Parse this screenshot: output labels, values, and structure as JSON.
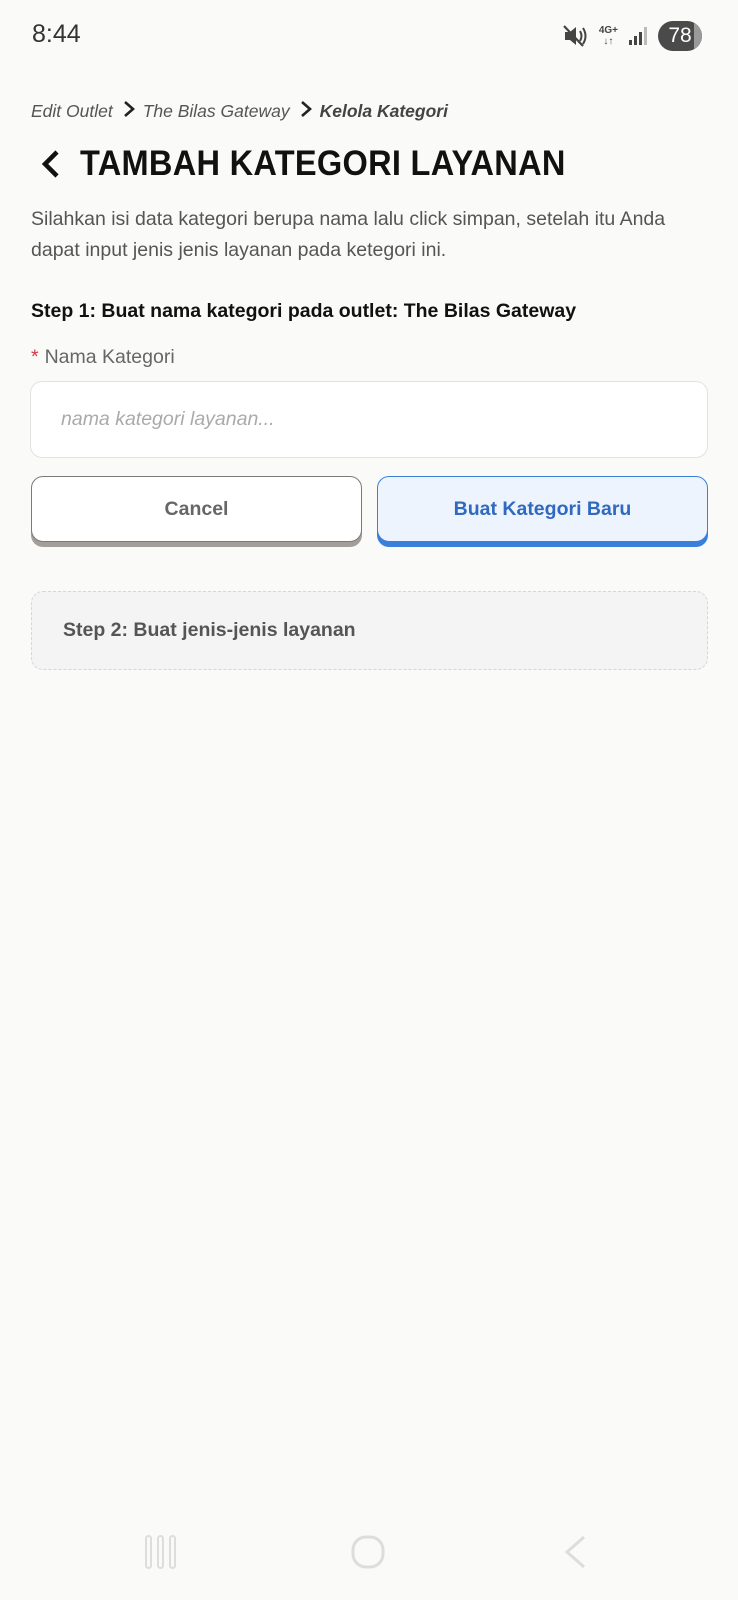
{
  "status_bar": {
    "time": "8:44",
    "network": "4G+",
    "battery": "78",
    "icons": [
      "mute-icon",
      "network-icon",
      "signal-icon",
      "battery-icon"
    ]
  },
  "breadcrumb": {
    "items": [
      "Edit Outlet",
      "The Bilas Gateway",
      "Kelola Kategori"
    ]
  },
  "header": {
    "title": "TAMBAH KATEGORI LAYANAN",
    "back_icon": "chevron-left-icon"
  },
  "description": "Silahkan isi data kategori berupa nama lalu click simpan, setelah itu Anda dapat input jenis jenis layanan pada ketegori ini.",
  "step1": {
    "label": "Step 1: Buat nama kategori pada outlet:",
    "outlet": "The Bilas Gateway"
  },
  "form": {
    "required_mark": "*",
    "field_label": "Nama Kategori",
    "value": "",
    "placeholder": "nama kategori layanan..."
  },
  "buttons": {
    "cancel": "Cancel",
    "create": "Buat Kategori Baru"
  },
  "step2": {
    "label": "Step 2: Buat jenis-jenis layanan"
  },
  "nav_bar": {
    "icons": [
      "recent-apps-icon",
      "home-icon",
      "back-nav-icon"
    ]
  },
  "colors": {
    "background": "#fafaf9",
    "accent": "#3a7fdb",
    "required": "#d9363e"
  }
}
